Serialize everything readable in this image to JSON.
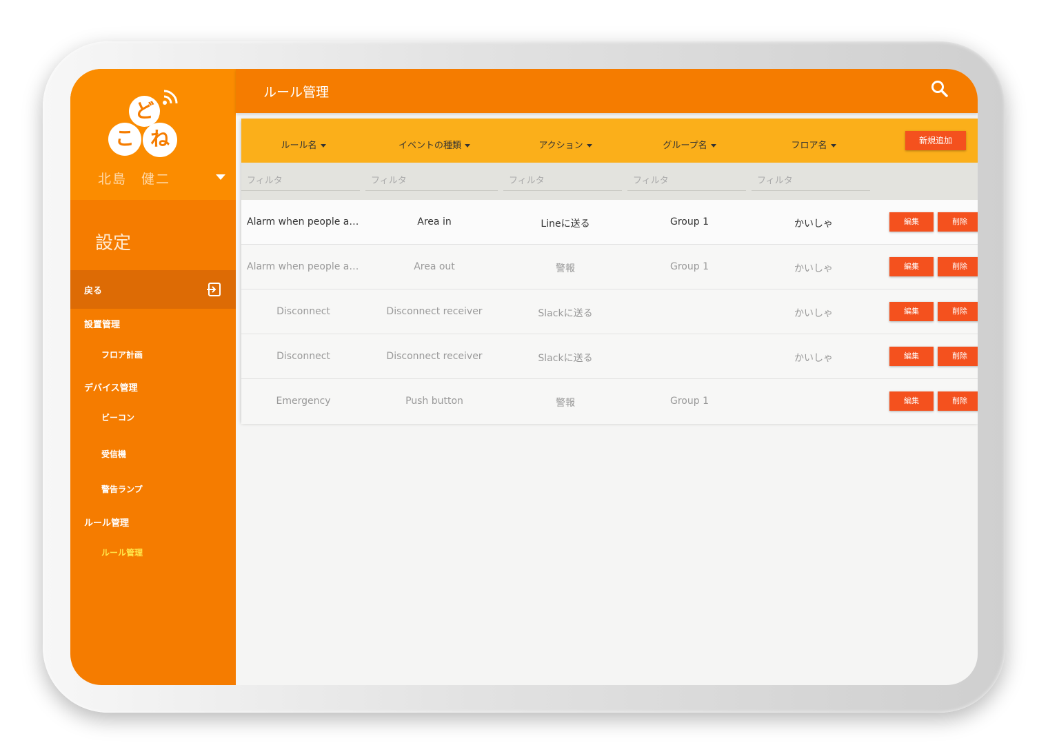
{
  "app": {
    "logo_chars": [
      "ど",
      "こ",
      "ね"
    ],
    "user_name": "北島　健二"
  },
  "sidebar": {
    "section_title": "設定",
    "back_label": "戻る",
    "groups": [
      {
        "label": "設置管理",
        "items": [
          "フロア計画"
        ]
      },
      {
        "label": "デバイス管理",
        "items": [
          "ビーコン",
          "受信機",
          "警告ランプ"
        ]
      },
      {
        "label": "ルール管理",
        "items": [
          "ルール管理"
        ]
      }
    ]
  },
  "header": {
    "title": "ルール管理"
  },
  "table": {
    "columns": [
      "ルール名",
      "イベントの種類",
      "アクション",
      "グループ名",
      "フロア名"
    ],
    "add_label": "新規追加",
    "filter_placeholder": "フィルタ",
    "edit_label": "編集",
    "delete_label": "削除",
    "rows": [
      [
        "Alarm when people a…",
        "Area in",
        "Lineに送る",
        "Group 1",
        "かいしゃ"
      ],
      [
        "Alarm when people a…",
        "Area out",
        "警報",
        "Group 1",
        "かいしゃ"
      ],
      [
        "Disconnect",
        "Disconnect receiver",
        "Slackに送る",
        "",
        "かいしゃ"
      ],
      [
        "Disconnect",
        "Disconnect receiver",
        "Slackに送る",
        "",
        "かいしゃ"
      ],
      [
        "Emergency",
        "Push button",
        "警報",
        "Group 1",
        ""
      ]
    ]
  },
  "colors": {
    "sidebar": "#f57c00",
    "header": "#f57c00",
    "table_header": "#fbaf1a",
    "button": "#f4511e",
    "active_nav": "#ffe74a"
  }
}
